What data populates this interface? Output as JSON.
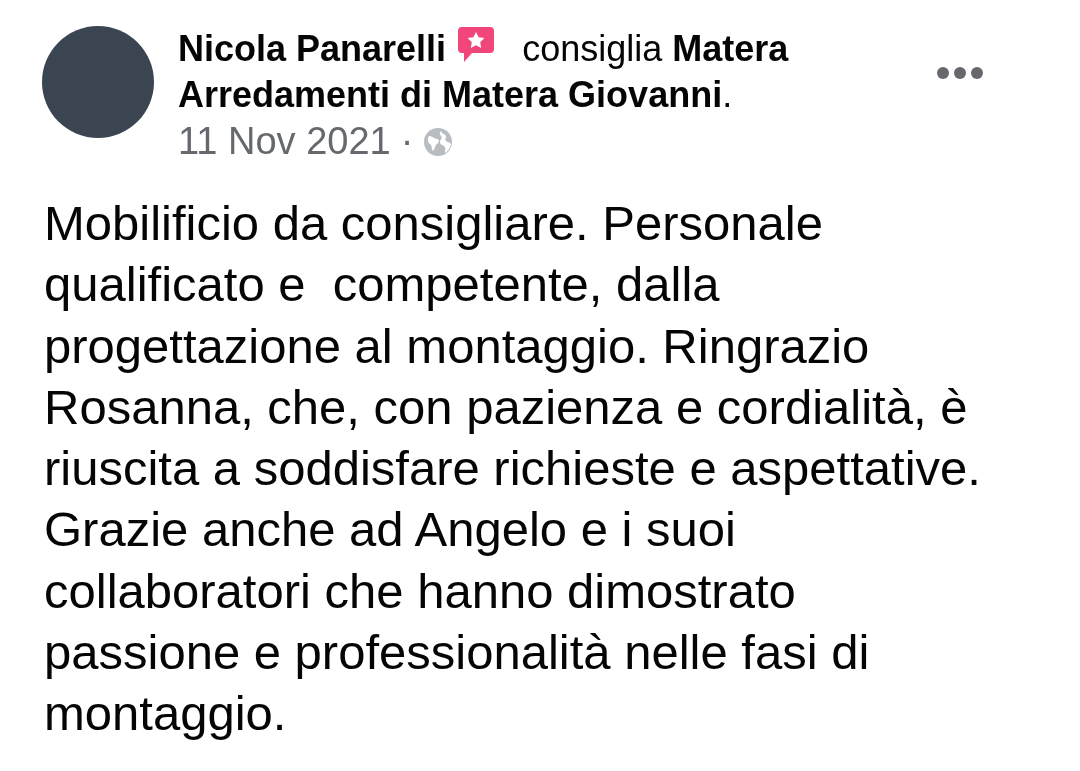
{
  "post": {
    "author": "Nicola Panarelli",
    "action": "consiglia **Matera**",
    "action_cont": "**Arredamenti di Matera Giovanni**.",
    "date": "11 Nov 2021",
    "separator": "·",
    "body": "Mobilificio da consigliare. Personale qualificato e  competente, dalla progettazione al montaggio. Ringrazio Rosanna, che, con pazienza e cordialità, è riuscita a soddisfare richieste e aspettative. Grazie anche ad Angelo e i suoi collaboratori che hanno dimostrato passione e professionalità nelle fasi di montaggio."
  }
}
